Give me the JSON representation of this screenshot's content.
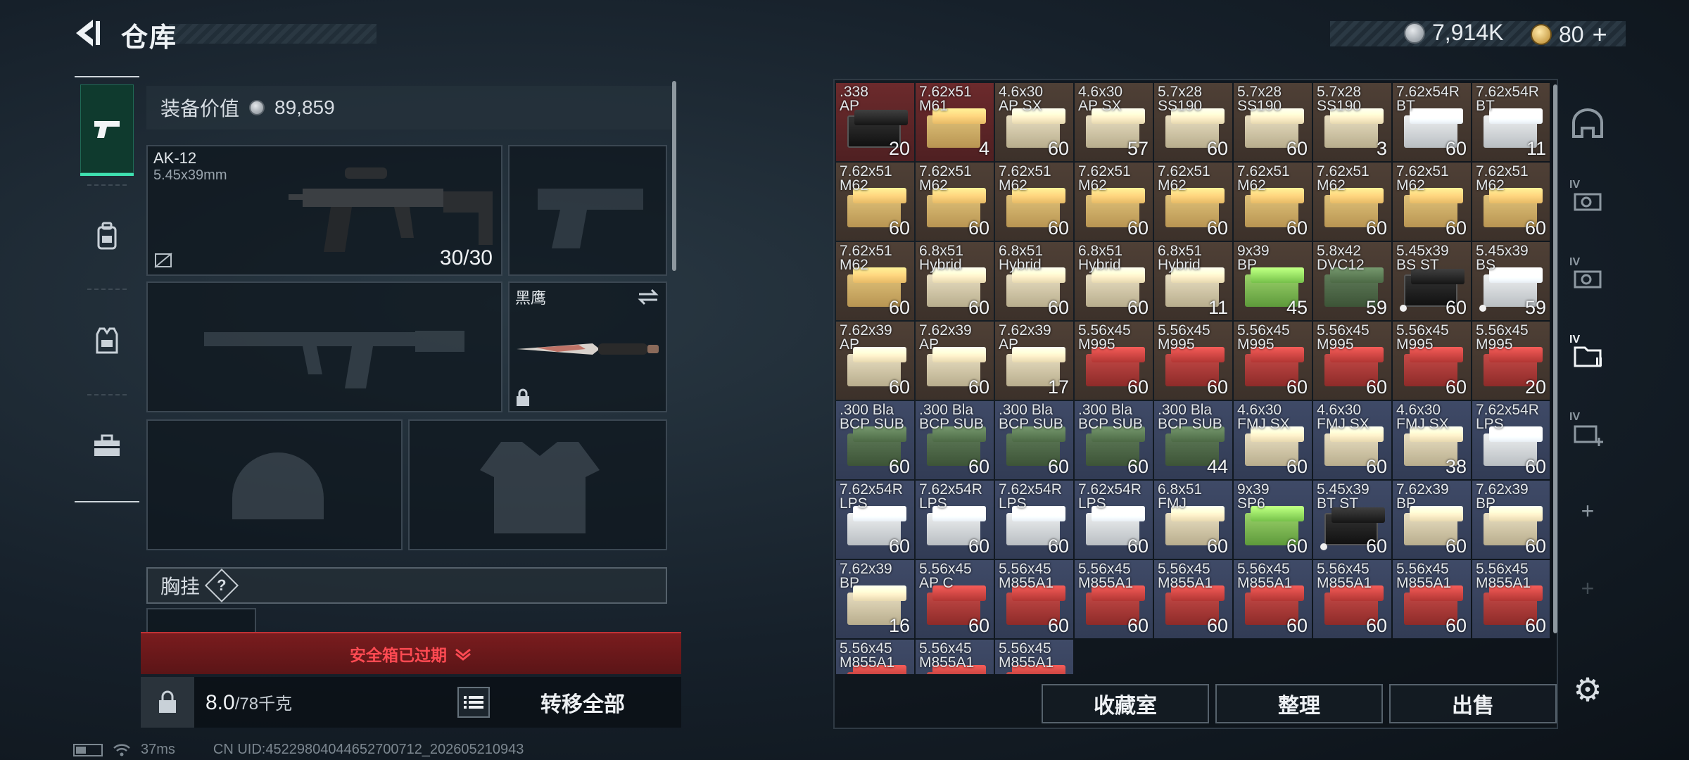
{
  "header": {
    "title": "仓库"
  },
  "currency": {
    "coin": "7,914K",
    "gold": "80",
    "plus": "+"
  },
  "left_nav": {
    "items": [
      "weapon",
      "backpack",
      "armor",
      "toolbox"
    ]
  },
  "equipment": {
    "value_label": "装备价值",
    "value": "89,859",
    "primary_weapon": {
      "name": "AK-12",
      "caliber": "5.45x39mm",
      "ammo": "30/30"
    },
    "melee": {
      "name": "黑鹰"
    }
  },
  "chest_rig": {
    "label": "胸挂",
    "help": "?"
  },
  "safe_box": {
    "status": "安全箱已过期"
  },
  "weight": {
    "current": "8.0",
    "max": "/78千克"
  },
  "buttons": {
    "transfer_all": "转移全部",
    "collection": "收藏室",
    "organize": "整理",
    "sell": "出售"
  },
  "right_tabs": {
    "iv_label": "IV",
    "add": "+"
  },
  "status_bar": {
    "ping": "37ms",
    "uid": "CN UID:45229804044652700712_202605210943"
  },
  "colors": {
    "accent": "#3fe0b0",
    "alert": "#ff4a52"
  },
  "storage": {
    "items": [
      {
        "name": ".338\nAP",
        "count": "20",
        "bg": "red",
        "box": "black"
      },
      {
        "name": "7.62x51\nM61",
        "count": "4",
        "bg": "red",
        "box": "tan"
      },
      {
        "name": "4.6x30\nAP SX",
        "count": "60",
        "bg": "brown",
        "box": "cream"
      },
      {
        "name": "4.6x30\nAP SX",
        "count": "57",
        "bg": "brown",
        "box": "cream"
      },
      {
        "name": "5.7x28\nSS190",
        "count": "60",
        "bg": "brown",
        "box": "cream"
      },
      {
        "name": "5.7x28\nSS190",
        "count": "60",
        "bg": "brown",
        "box": "cream"
      },
      {
        "name": "5.7x28\nSS190",
        "count": "3",
        "bg": "brown",
        "box": "cream"
      },
      {
        "name": "7.62x54R\nBT",
        "count": "60",
        "bg": "brown",
        "box": "white"
      },
      {
        "name": "7.62x54R\nBT",
        "count": "11",
        "bg": "brown",
        "box": "white"
      },
      {
        "name": "7.62x51\nM62",
        "count": "60",
        "bg": "brown",
        "box": "tan"
      },
      {
        "name": "7.62x51\nM62",
        "count": "60",
        "bg": "brown",
        "box": "tan"
      },
      {
        "name": "7.62x51\nM62",
        "count": "60",
        "bg": "brown",
        "box": "tan"
      },
      {
        "name": "7.62x51\nM62",
        "count": "60",
        "bg": "brown",
        "box": "tan"
      },
      {
        "name": "7.62x51\nM62",
        "count": "60",
        "bg": "brown",
        "box": "tan"
      },
      {
        "name": "7.62x51\nM62",
        "count": "60",
        "bg": "brown",
        "box": "tan"
      },
      {
        "name": "7.62x51\nM62",
        "count": "60",
        "bg": "brown",
        "box": "tan"
      },
      {
        "name": "7.62x51\nM62",
        "count": "60",
        "bg": "brown",
        "box": "tan"
      },
      {
        "name": "7.62x51\nM62",
        "count": "60",
        "bg": "brown",
        "box": "tan"
      },
      {
        "name": "7.62x51\nM62",
        "count": "60",
        "bg": "brown",
        "box": "tan"
      },
      {
        "name": "6.8x51\nHybrid",
        "count": "60",
        "bg": "brown",
        "box": "cream"
      },
      {
        "name": "6.8x51\nHybrid",
        "count": "60",
        "bg": "brown",
        "box": "cream"
      },
      {
        "name": "6.8x51\nHybrid",
        "count": "60",
        "bg": "brown",
        "box": "cream"
      },
      {
        "name": "6.8x51\nHybrid",
        "count": "11",
        "bg": "brown",
        "box": "cream"
      },
      {
        "name": "9x39\nBP",
        "count": "45",
        "bg": "brown",
        "box": "green"
      },
      {
        "name": "5.8x42\nDVC12",
        "count": "59",
        "bg": "brown",
        "box": "olive"
      },
      {
        "name": "5.45x39\nBS ST",
        "count": "60",
        "bg": "brown",
        "box": "black",
        "dot": true
      },
      {
        "name": "5.45x39\nBS",
        "count": "59",
        "bg": "brown",
        "box": "white",
        "dot": true
      },
      {
        "name": "7.62x39\nAP",
        "count": "60",
        "bg": "brown",
        "box": "cream"
      },
      {
        "name": "7.62x39\nAP",
        "count": "60",
        "bg": "brown",
        "box": "cream"
      },
      {
        "name": "7.62x39\nAP",
        "count": "17",
        "bg": "brown",
        "box": "cream"
      },
      {
        "name": "5.56x45\nM995",
        "count": "60",
        "bg": "brown",
        "box": "red"
      },
      {
        "name": "5.56x45\nM995",
        "count": "60",
        "bg": "brown",
        "box": "red"
      },
      {
        "name": "5.56x45\nM995",
        "count": "60",
        "bg": "brown",
        "box": "red"
      },
      {
        "name": "5.56x45\nM995",
        "count": "60",
        "bg": "brown",
        "box": "red"
      },
      {
        "name": "5.56x45\nM995",
        "count": "60",
        "bg": "brown",
        "box": "red"
      },
      {
        "name": "5.56x45\nM995",
        "count": "20",
        "bg": "brown",
        "box": "red"
      },
      {
        "name": ".300 Bla\nBCP SUB",
        "count": "60",
        "bg": "blue",
        "box": "olive"
      },
      {
        "name": ".300 Bla\nBCP SUB",
        "count": "60",
        "bg": "blue",
        "box": "olive"
      },
      {
        "name": ".300 Bla\nBCP SUB",
        "count": "60",
        "bg": "blue",
        "box": "olive"
      },
      {
        "name": ".300 Bla\nBCP SUB",
        "count": "60",
        "bg": "blue",
        "box": "olive"
      },
      {
        "name": ".300 Bla\nBCP SUB",
        "count": "44",
        "bg": "blue",
        "box": "olive"
      },
      {
        "name": "4.6x30\nFMJ SX",
        "count": "60",
        "bg": "blue",
        "box": "cream"
      },
      {
        "name": "4.6x30\nFMJ SX",
        "count": "60",
        "bg": "blue",
        "box": "cream"
      },
      {
        "name": "4.6x30\nFMJ SX",
        "count": "38",
        "bg": "blue",
        "box": "cream"
      },
      {
        "name": "7.62x54R\nLPS",
        "count": "60",
        "bg": "blue",
        "box": "white"
      },
      {
        "name": "7.62x54R\nLPS",
        "count": "60",
        "bg": "blue",
        "box": "white"
      },
      {
        "name": "7.62x54R\nLPS",
        "count": "60",
        "bg": "blue",
        "box": "white"
      },
      {
        "name": "7.62x54R\nLPS",
        "count": "60",
        "bg": "blue",
        "box": "white"
      },
      {
        "name": "7.62x54R\nLPS",
        "count": "60",
        "bg": "blue",
        "box": "white"
      },
      {
        "name": "6.8x51\nFMJ",
        "count": "60",
        "bg": "blue",
        "box": "cream"
      },
      {
        "name": "9x39\nSP6",
        "count": "60",
        "bg": "blue",
        "box": "green"
      },
      {
        "name": "5.45x39\nBT ST",
        "count": "60",
        "bg": "blue",
        "box": "black",
        "dot": true
      },
      {
        "name": "7.62x39\nBP",
        "count": "60",
        "bg": "blue",
        "box": "cream"
      },
      {
        "name": "7.62x39\nBP",
        "count": "60",
        "bg": "blue",
        "box": "cream"
      },
      {
        "name": "7.62x39\nBP",
        "count": "16",
        "bg": "blue",
        "box": "cream"
      },
      {
        "name": "5.56x45\nAP C",
        "count": "60",
        "bg": "blue",
        "box": "red"
      },
      {
        "name": "5.56x45\nM855A1",
        "count": "60",
        "bg": "blue",
        "box": "red"
      },
      {
        "name": "5.56x45\nM855A1",
        "count": "60",
        "bg": "blue",
        "box": "red"
      },
      {
        "name": "5.56x45\nM855A1",
        "count": "60",
        "bg": "blue",
        "box": "red"
      },
      {
        "name": "5.56x45\nM855A1",
        "count": "60",
        "bg": "blue",
        "box": "red"
      },
      {
        "name": "5.56x45\nM855A1",
        "count": "60",
        "bg": "blue",
        "box": "red"
      },
      {
        "name": "5.56x45\nM855A1",
        "count": "60",
        "bg": "blue",
        "box": "red"
      },
      {
        "name": "5.56x45\nM855A1",
        "count": "60",
        "bg": "blue",
        "box": "red"
      },
      {
        "name": "5.56x45\nM855A1",
        "count": "",
        "bg": "blue",
        "box": "red"
      },
      {
        "name": "5.56x45\nM855A1",
        "count": "",
        "bg": "blue",
        "box": "red"
      },
      {
        "name": "5.56x45\nM855A1",
        "count": "",
        "bg": "blue",
        "box": "red"
      }
    ]
  }
}
